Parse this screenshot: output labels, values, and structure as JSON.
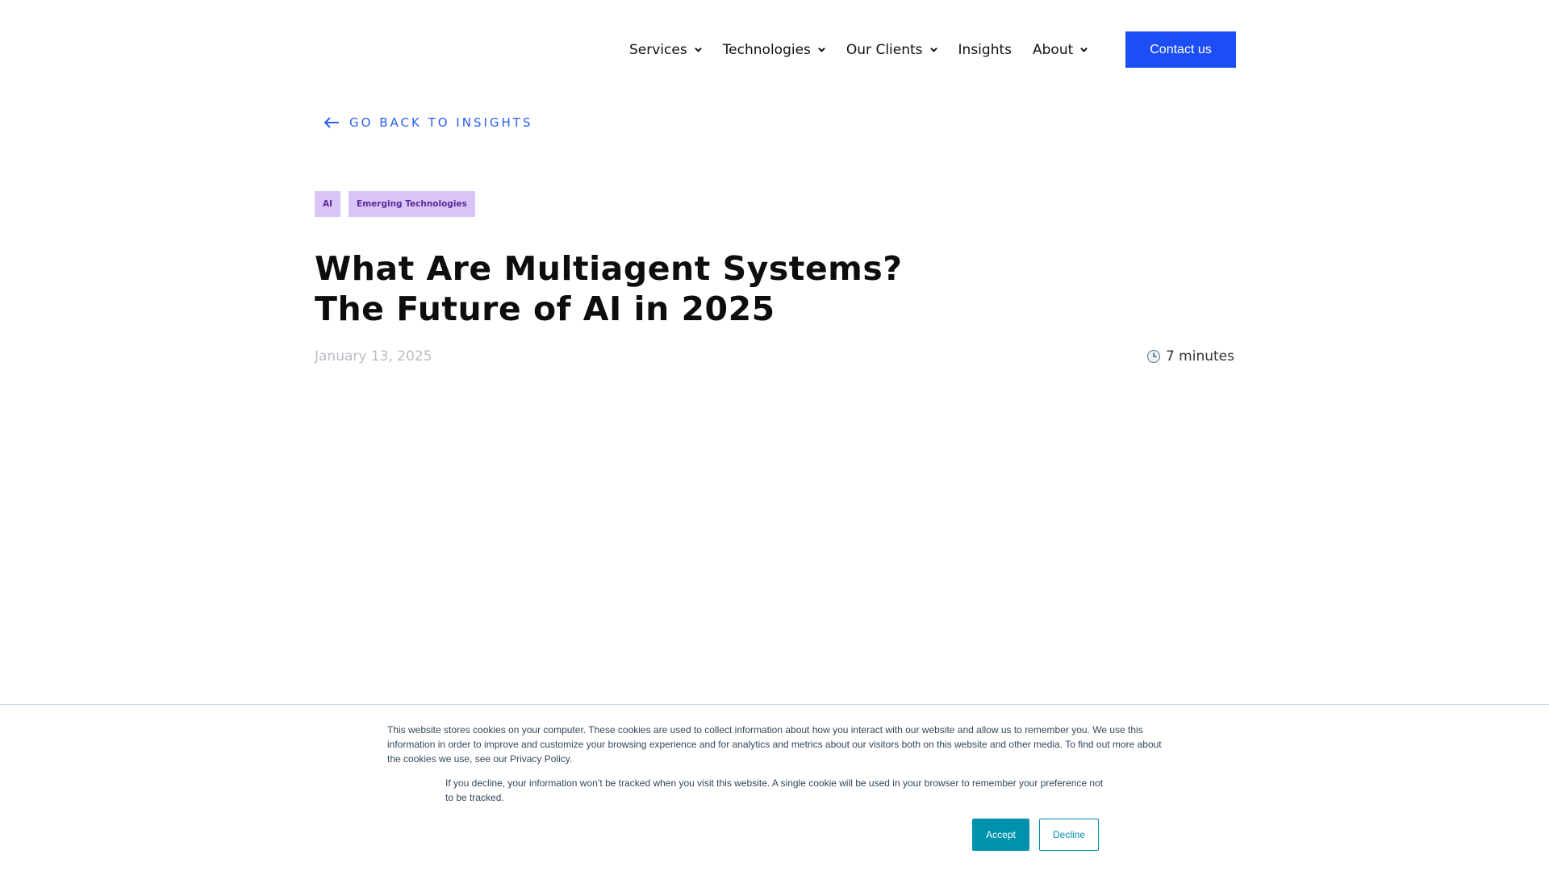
{
  "nav": {
    "items": [
      {
        "label": "Services",
        "has_dropdown": true
      },
      {
        "label": "Technologies",
        "has_dropdown": true
      },
      {
        "label": "Our Clients",
        "has_dropdown": true
      },
      {
        "label": "Insights",
        "has_dropdown": false
      },
      {
        "label": "About",
        "has_dropdown": true
      }
    ],
    "contact_label": "Contact us",
    "contact_color": "#1d4ef5"
  },
  "article": {
    "back_label": "GO BACK TO INSIGHTS",
    "tags": [
      "AI",
      "Emerging Technologies"
    ],
    "title_line1": "What Are Multiagent Systems?",
    "title_line2": "The Future of AI in 2025",
    "date": "January 13, 2025",
    "read_time": "7 minutes",
    "read_time_icon": "clock-icon"
  },
  "cookie": {
    "text1": "This website stores cookies on your computer. These cookies are used to collect information about how you interact with our website and allow us to remember you. We use this information in order to improve and customize your browsing experience and for analytics and metrics about our visitors both on this website and other media. To find out more about the cookies we use, see our Privacy Policy.",
    "text2": "If you decline, your information won’t be tracked when you visit this website. A single cookie will be used in your browser to remember your preference not to be tracked.",
    "accept_label": "Accept",
    "decline_label": "Decline",
    "accent_color": "#0091ae"
  }
}
